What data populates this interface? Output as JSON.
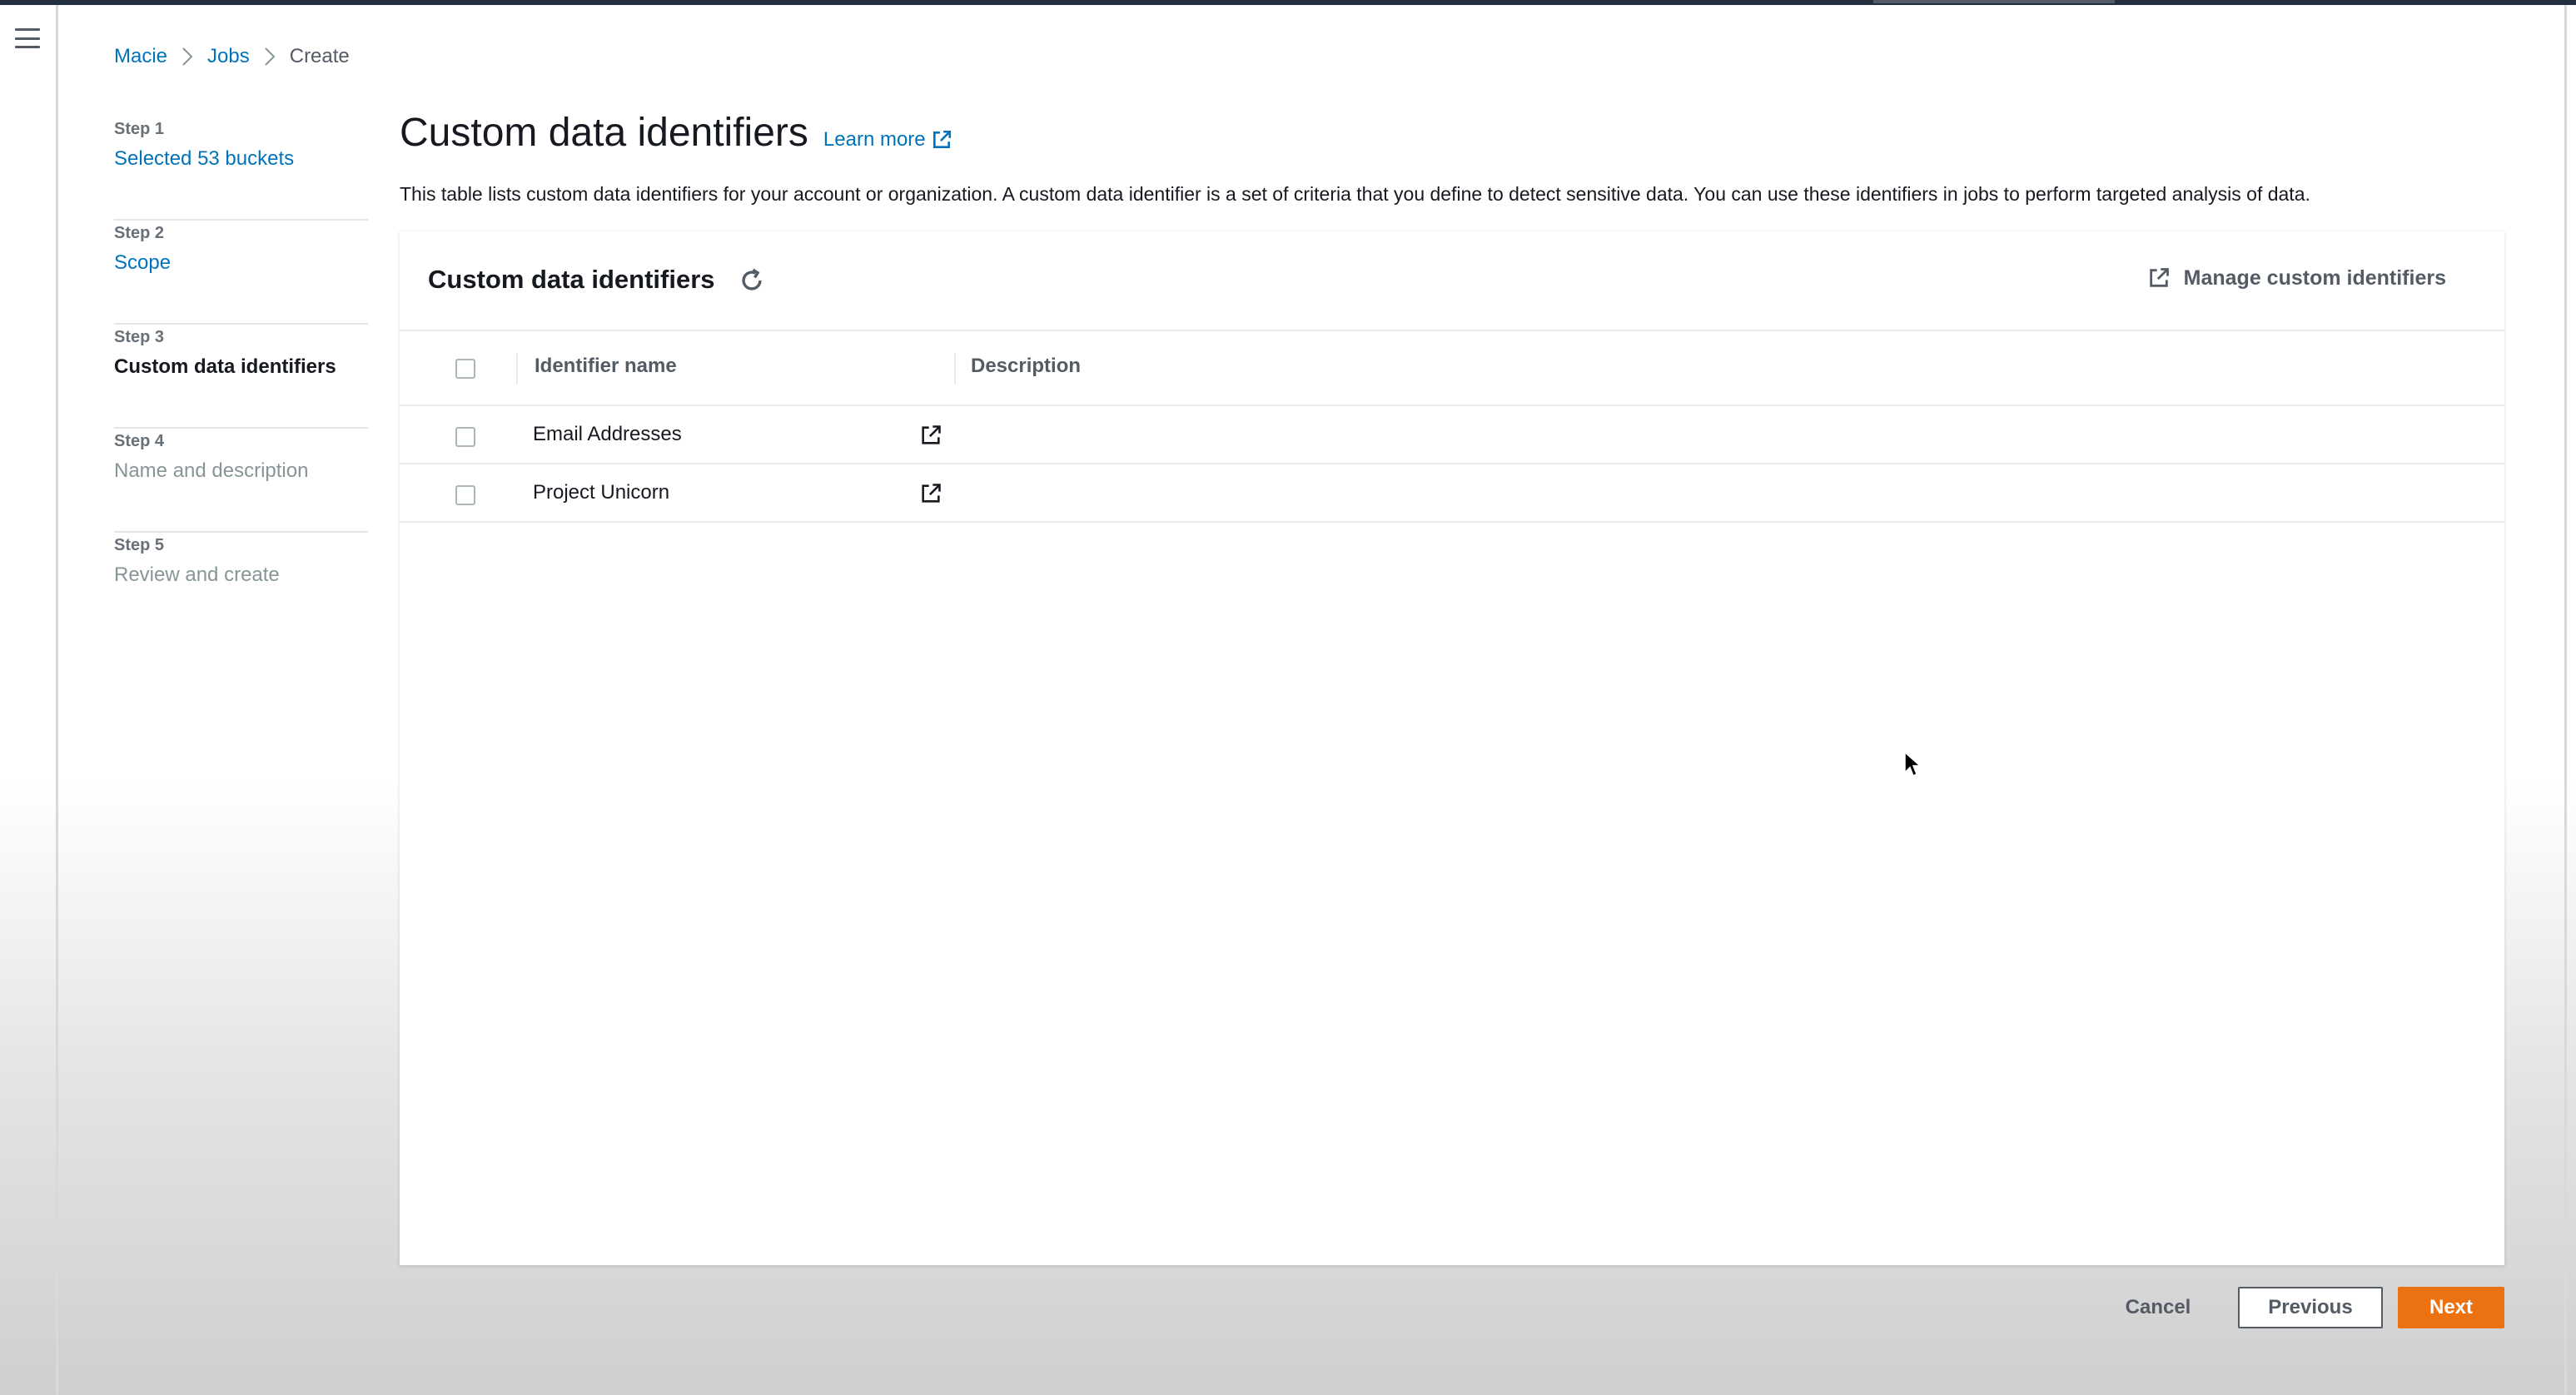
{
  "breadcrumb": {
    "items": [
      "Macie",
      "Jobs"
    ],
    "current": "Create"
  },
  "steps": [
    {
      "number": "Step 1",
      "label": "Selected 53 buckets",
      "state": "link"
    },
    {
      "number": "Step 2",
      "label": "Scope",
      "state": "link"
    },
    {
      "number": "Step 3",
      "label": "Custom data identifiers",
      "state": "current"
    },
    {
      "number": "Step 4",
      "label": "Name and description",
      "state": "disabled"
    },
    {
      "number": "Step 5",
      "label": "Review and create",
      "state": "disabled"
    }
  ],
  "header": {
    "title": "Custom data identifiers",
    "learn_more": "Learn more",
    "description": "This table lists custom data identifiers for your account or organization. A custom data identifier is a set of criteria that you define to detect sensitive data. You can use these identifiers in jobs to perform targeted analysis of data."
  },
  "table": {
    "title": "Custom data identifiers",
    "manage_label": "Manage custom identifiers",
    "columns": [
      "Identifier name",
      "Description"
    ],
    "rows": [
      {
        "name": "Email Addresses",
        "description": ""
      },
      {
        "name": "Project Unicorn",
        "description": ""
      }
    ]
  },
  "footer": {
    "cancel": "Cancel",
    "previous": "Previous",
    "next": "Next"
  },
  "colors": {
    "link": "#0073bb",
    "primary_button": "#ec7211",
    "text": "#16191f",
    "muted": "#545b64"
  },
  "icons": [
    "menu-icon",
    "chevron-right-icon",
    "external-link-icon",
    "refresh-icon",
    "checkbox-icon",
    "mouse-cursor-icon"
  ]
}
